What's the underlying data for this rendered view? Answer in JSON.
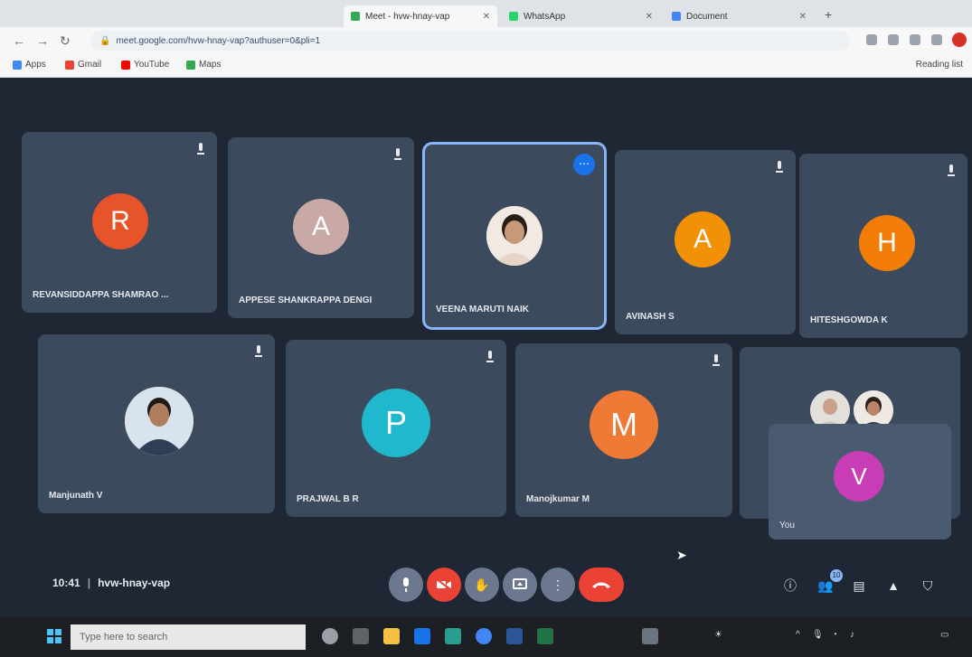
{
  "browser": {
    "tabs": [
      {
        "label": "Meet - hvw-hnay-vap",
        "color": "#34a853",
        "active": true
      },
      {
        "label": "WhatsApp",
        "color": "#25d366",
        "active": false
      },
      {
        "label": "Document",
        "color": "#4285f4",
        "active": false
      }
    ],
    "url": "meet.google.com/hvw-hnay-vap?authuser=0&pli=1",
    "bookmarks": [
      {
        "label": "Apps",
        "color": "#4285f4"
      },
      {
        "label": "Gmail",
        "color": "#ea4335"
      },
      {
        "label": "YouTube",
        "color": "#ff0000"
      },
      {
        "label": "Maps",
        "color": "#34a853"
      }
    ],
    "reading_list": "Reading list"
  },
  "participants": [
    {
      "name": "REVANSIDDAPPA SHAMRAO ...",
      "initial": "R",
      "color": "#e8542a",
      "type": "initial"
    },
    {
      "name": "APPESE SHANKRAPPA DENGI",
      "initial": "A",
      "color": "#c9a9a6",
      "type": "initial"
    },
    {
      "name": "VEENA MARUTI NAIK",
      "initial": "",
      "color": "",
      "type": "photo",
      "pinned": true
    },
    {
      "name": "AVINASH S",
      "initial": "A",
      "color": "#f29106",
      "type": "initial"
    },
    {
      "name": "HITESHGOWDA K",
      "initial": "H",
      "color": "#f27d06",
      "type": "initial"
    },
    {
      "name": "Manjunath V",
      "initial": "",
      "color": "",
      "type": "photo"
    },
    {
      "name": "PRAJWAL B R",
      "initial": "P",
      "color": "#1fb8cd",
      "type": "initial"
    },
    {
      "name": "Manojkumar M",
      "initial": "M",
      "color": "#ee7a36",
      "type": "initial"
    },
    {
      "name": "",
      "initial": "",
      "color": "",
      "type": "group"
    }
  ],
  "self": {
    "name": "You",
    "initial": "V",
    "color": "#c83db5"
  },
  "meeting": {
    "time": "10:41",
    "code": "hvw-hnay-vap"
  },
  "controls": {
    "mic": "mic-icon",
    "cam": "camera-off-icon",
    "hand": "raise-hand-icon",
    "present": "present-icon",
    "more": "more-options-icon",
    "end": "end-call-icon"
  },
  "right_controls": {
    "participants_count": "10"
  },
  "taskbar": {
    "search_placeholder": "Type here to search"
  }
}
